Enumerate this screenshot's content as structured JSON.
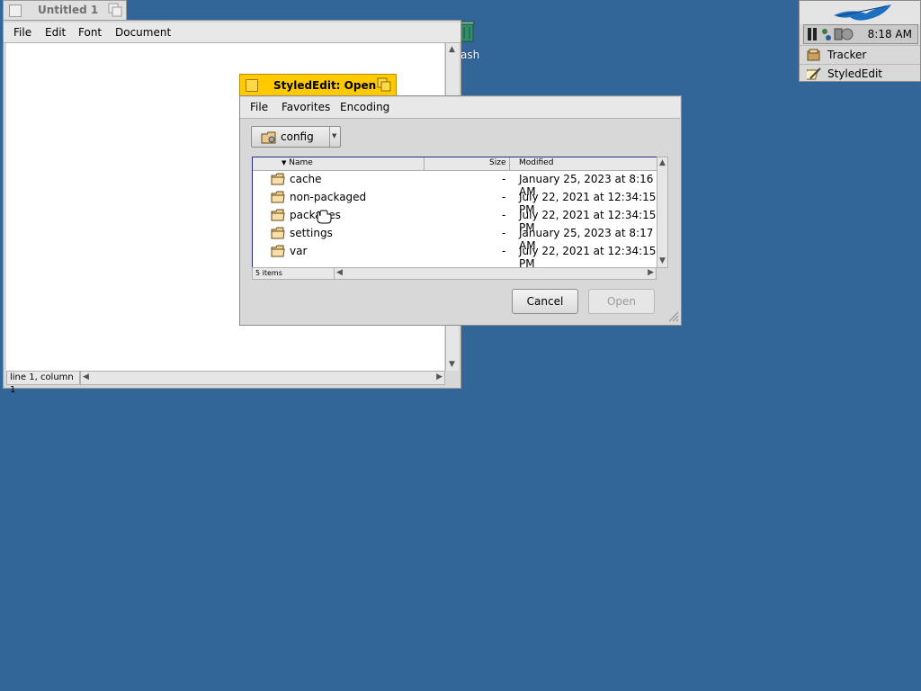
{
  "desktop": {
    "trash_label": "ash"
  },
  "deskbar": {
    "clock": "8:18 AM",
    "apps": [
      {
        "label": "Tracker",
        "icon": "tracker-icon"
      },
      {
        "label": "StyledEdit",
        "icon": "stylededit-icon"
      }
    ]
  },
  "untitled_window": {
    "title": "Untitled 1",
    "menu": [
      "File",
      "Edit",
      "Font",
      "Document"
    ],
    "status": "line 1, column 1"
  },
  "open_dialog": {
    "title": "StyledEdit: Open",
    "menu": [
      "File",
      "Favorites",
      "Encoding"
    ],
    "directory": "config",
    "columns": {
      "name": "Name",
      "size": "Size",
      "modified": "Modified"
    },
    "files": [
      {
        "name": "cache",
        "size": "-",
        "modified": "January 25, 2023 at 8:16 AM"
      },
      {
        "name": "non-packaged",
        "size": "-",
        "modified": "July 22, 2021 at 12:34:15 PM"
      },
      {
        "name": "packages",
        "size": "-",
        "modified": "July 22, 2021 at 12:34:15 PM"
      },
      {
        "name": "settings",
        "size": "-",
        "modified": "January 25, 2023 at 8:17 AM"
      },
      {
        "name": "var",
        "size": "-",
        "modified": "July 22, 2021 at 12:34:15 PM"
      }
    ],
    "item_count": "5 items",
    "cancel_label": "Cancel",
    "open_label": "Open"
  },
  "colors": {
    "desktop": "#336698",
    "active_tab": "#ffcb00"
  }
}
